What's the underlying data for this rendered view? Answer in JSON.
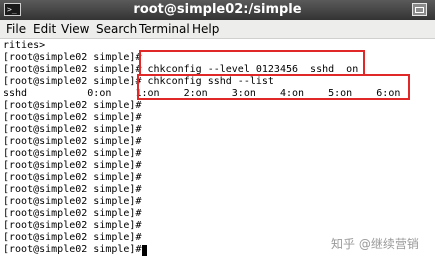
{
  "window": {
    "title": "root@simple02:/simple",
    "icon": "terminal-icon",
    "maximize_icon": "maximize-icon"
  },
  "menu": {
    "items": [
      {
        "label": "File"
      },
      {
        "label": "Edit"
      },
      {
        "label": "View"
      },
      {
        "label": "Search"
      },
      {
        "label": "Terminal"
      },
      {
        "label": "Help"
      }
    ]
  },
  "terminal": {
    "lines": [
      {
        "text": "rities>"
      },
      {
        "text": "[root@simple02 simple]#"
      },
      {
        "text": "[root@simple02 simple]# chkconfig --level 0123456  sshd  on"
      },
      {
        "text": "[root@simple02 simple]# chkconfig sshd --list"
      },
      {
        "text": "sshd          0:on    1:on    2:on    3:on    4:on    5:on    6:on"
      },
      {
        "text": "[root@simple02 simple]#"
      },
      {
        "text": "[root@simple02 simple]#"
      },
      {
        "text": "[root@simple02 simple]#"
      },
      {
        "text": "[root@simple02 simple]#"
      },
      {
        "text": "[root@simple02 simple]#"
      },
      {
        "text": "[root@simple02 simple]#"
      },
      {
        "text": "[root@simple02 simple]#"
      },
      {
        "text": "[root@simple02 simple]#"
      },
      {
        "text": "[root@simple02 simple]#"
      },
      {
        "text": "[root@simple02 simple]#"
      },
      {
        "text": "[root@simple02 simple]#"
      },
      {
        "text": "[root@simple02 simple]#"
      },
      {
        "text": "[root@simple02 simple]#"
      }
    ]
  },
  "highlight_color": "#e02828",
  "watermark": {
    "text": "知乎 @继续营销"
  }
}
